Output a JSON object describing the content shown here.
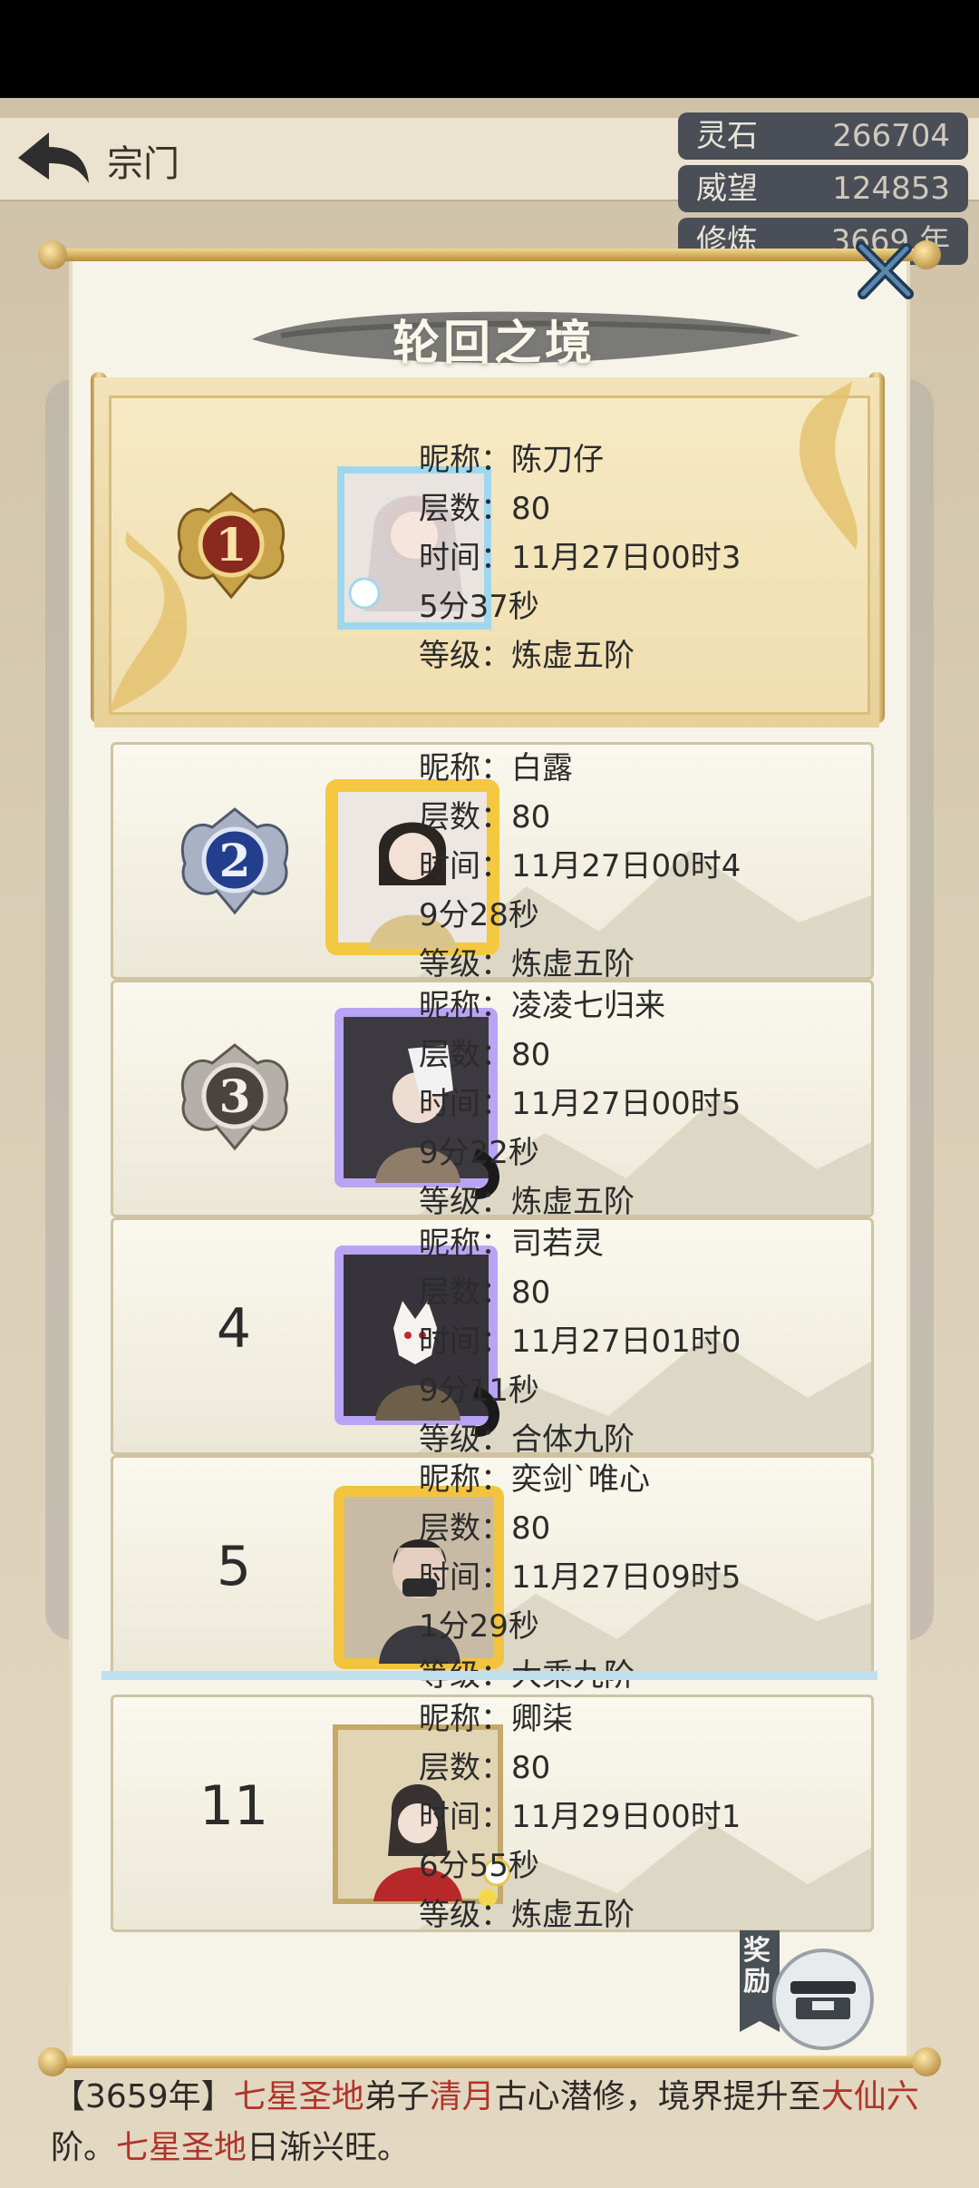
{
  "header": {
    "title": "宗门"
  },
  "resources": [
    {
      "label": "灵石",
      "value": "266704"
    },
    {
      "label": "威望",
      "value": "124853"
    },
    {
      "label": "修炼",
      "value": "3669 年"
    }
  ],
  "dialog": {
    "title": "轮回之境",
    "close_icon": "close-icon",
    "reward_label": "奖励"
  },
  "field_labels": {
    "nickname": "昵称：",
    "floors": "层数：",
    "time": "时间：",
    "level": "等级："
  },
  "entries": [
    {
      "rank": "1",
      "nickname": "陈刀仔",
      "floors": "80",
      "time_line1": "11月27日00时3",
      "time_line2": "5分37秒",
      "level": "炼虚五阶"
    },
    {
      "rank": "2",
      "nickname": "白露",
      "floors": "80",
      "time_line1": "11月27日00时4",
      "time_line2": "9分28秒",
      "level": "炼虚五阶"
    },
    {
      "rank": "3",
      "nickname": "凌凌七归来",
      "floors": "80",
      "time_line1": "11月27日00时5",
      "time_line2": "9分22秒",
      "level": "炼虚五阶"
    },
    {
      "rank": "4",
      "nickname": "司若灵",
      "floors": "80",
      "time_line1": "11月27日01时0",
      "time_line2": "9分11秒",
      "level": "合体九阶"
    },
    {
      "rank": "5",
      "nickname": "奕剑`唯心",
      "floors": "80",
      "time_line1": "11月27日09时5",
      "time_line2": "1分29秒",
      "level": "大乘九阶"
    },
    {
      "rank": "11",
      "nickname": "卿柒",
      "floors": "80",
      "time_line1": "11月29日00时1",
      "time_line2": "6分55秒",
      "level": "炼虚五阶"
    }
  ],
  "background_log": {
    "line1_a": "【3659年】",
    "line1_b": "七星圣地",
    "line1_c": "弟子",
    "line1_d": "清月",
    "line1_e": "古心潜修，境界提升至",
    "line1_f": "大仙六",
    "line2_a": "阶。",
    "line2_b": "七星圣地",
    "line2_c": "日渐兴旺。"
  },
  "colors": {
    "accent_red": "#b0342a",
    "panel": "#f6f3e8",
    "gold": "#e2c277"
  }
}
